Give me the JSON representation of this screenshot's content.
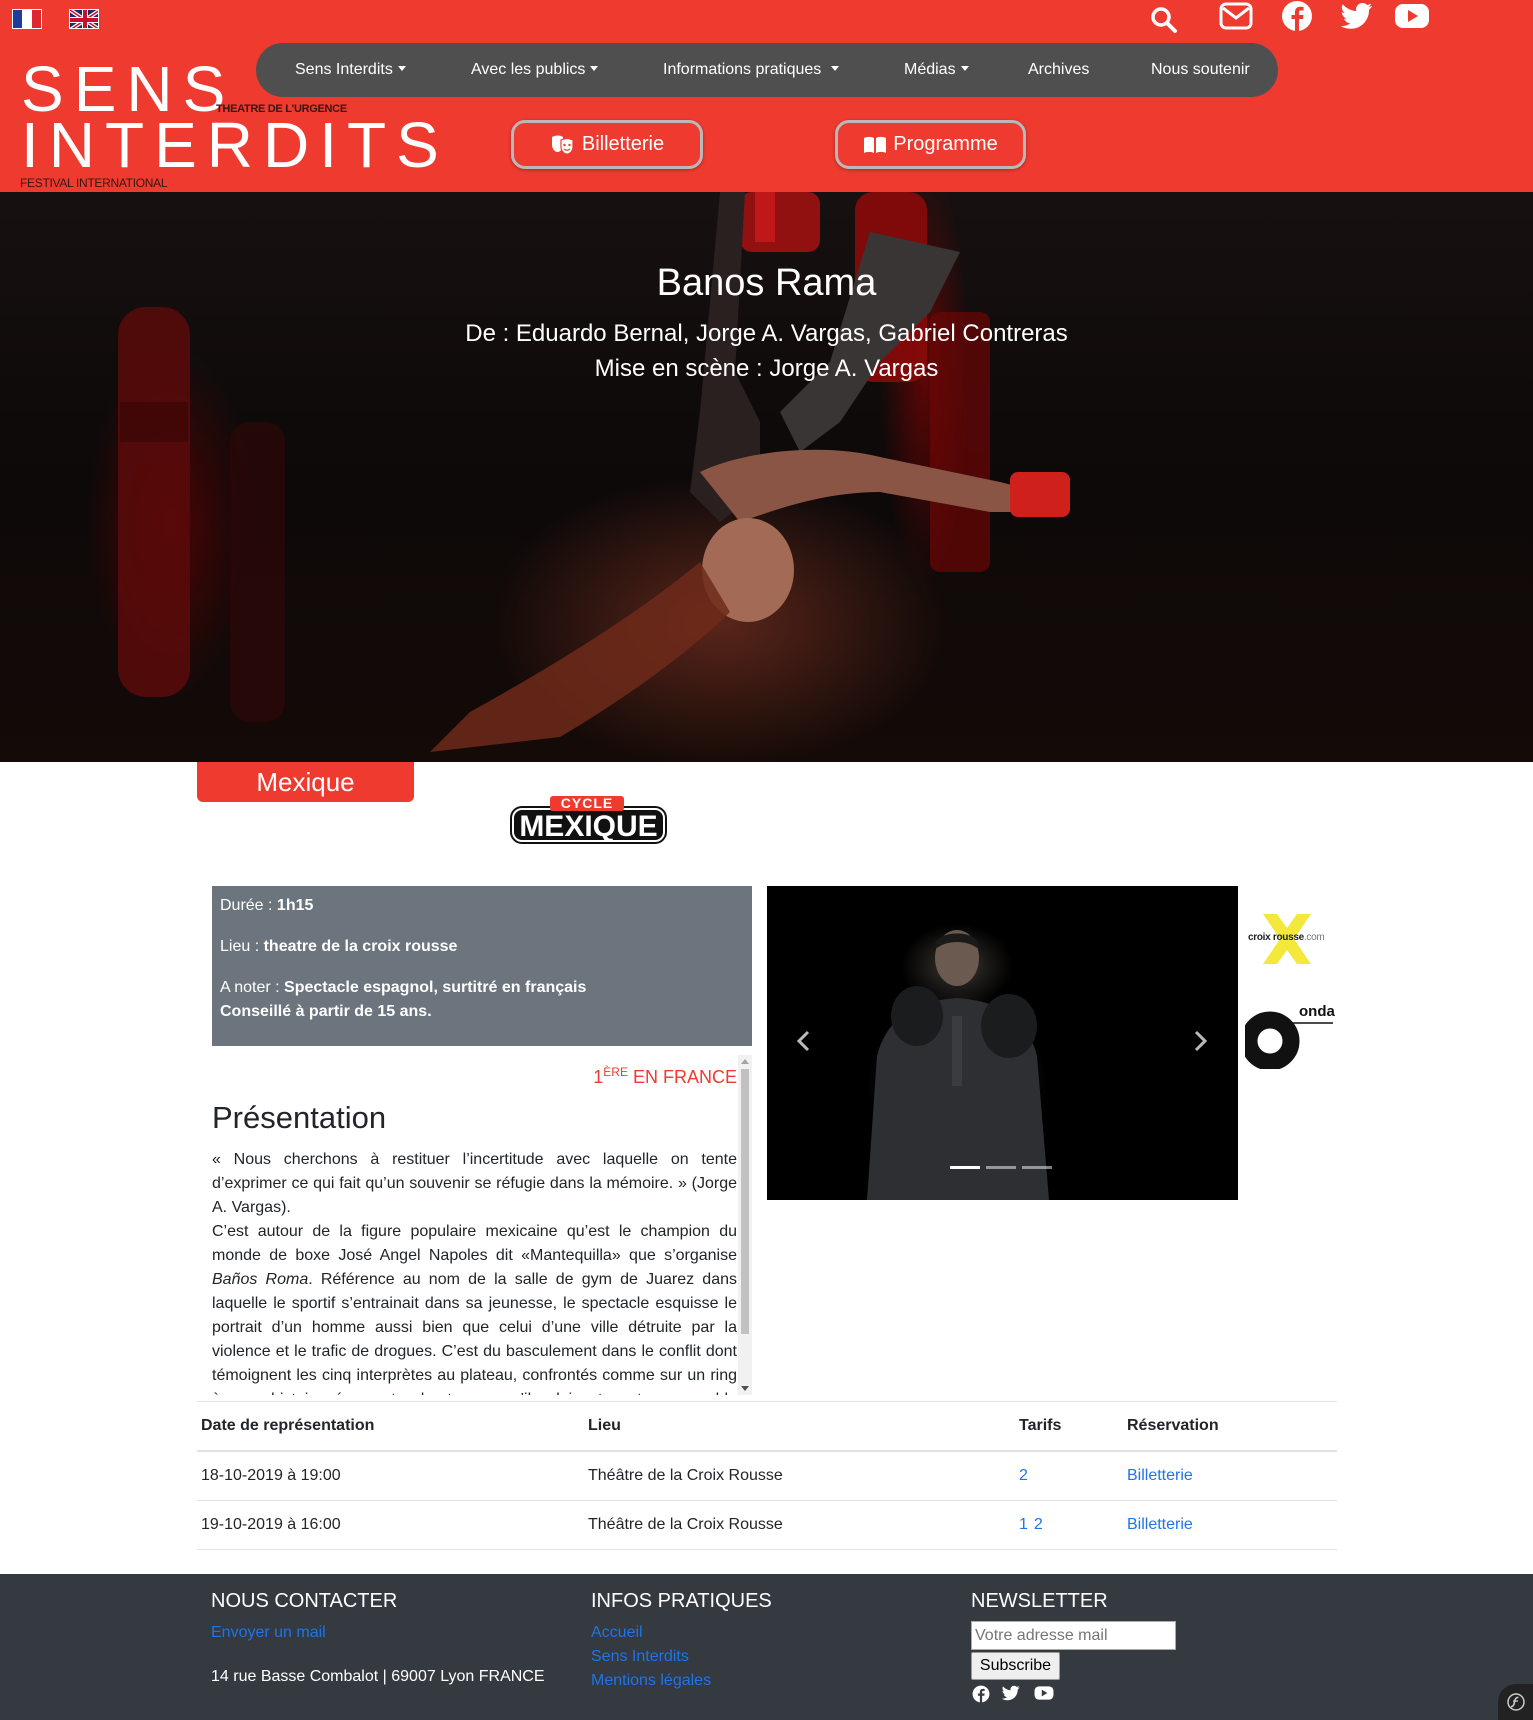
{
  "languages": [
    {
      "name": "Français",
      "icon": "flag-fr-icon"
    },
    {
      "name": "English",
      "icon": "flag-uk-icon"
    }
  ],
  "top_icons": [
    "search-icon",
    "mail-icon",
    "facebook-icon",
    "twitter-icon",
    "youtube-icon"
  ],
  "logo": {
    "line1": "SENS",
    "line2": "INTERDITS",
    "sub1": "THEATRE DE L'URGENCE",
    "sub2": "FESTIVAL INTERNATIONAL"
  },
  "nav": {
    "items": [
      {
        "label": "Sens Interdits",
        "dropdown": true
      },
      {
        "label": "Avec les publics",
        "dropdown": true
      },
      {
        "label": "Informations pratiques ",
        "dropdown": true
      },
      {
        "label": "Médias",
        "dropdown": true
      },
      {
        "label": "Archives",
        "dropdown": false
      },
      {
        "label": "Nous soutenir",
        "dropdown": false
      }
    ]
  },
  "buttons": {
    "billetterie": "Billetterie",
    "programme": "Programme"
  },
  "hero": {
    "title": "Banos Rama",
    "authors": "De : Eduardo Bernal, Jorge A. Vargas, Gabriel Contreras",
    "direction": "Mise en scène : Jorge A. Vargas"
  },
  "country": "Mexique",
  "cycle_logo": {
    "top": "CYCLE",
    "main": "MEXIQUE"
  },
  "info": {
    "duree_label": "Durée : ",
    "duree_value": "1h15",
    "lieu_label": "Lieu : ",
    "lieu_value": "theatre de la croix rousse",
    "noter_label": "A noter : ",
    "noter_value": "Spectacle espagnol, surtitré en français",
    "noter_value2": "Conseillé à partir de 15 ans."
  },
  "presentation": {
    "premiere_num": "1",
    "premiere_sup": "ÈRE",
    "premiere_text": " EN FRANCE",
    "heading": "Présentation",
    "p1": "« Nous cherchons à restituer l’incertitude avec laquelle on tente d’exprimer ce qui fait qu’un souvenir se réfugie dans la mémoire. » (Jorge A. Vargas).",
    "p2a": "C’est autour de la figure populaire mexicaine qu’est le champion du monde de boxe José Angel Napoles dit «Mantequilla» que s’organise ",
    "p2_italic": "Baños Roma",
    "p2b": ". Référence au nom de la salle de gym de Juarez dans laquelle le sportif s’entrainait dans sa jeunesse, le spectacle esquisse le portrait d’un homme aussi bien que celui d’une ville détruite par la violence et le trafic de drogues. C’est du basculement dans le conflit dont témoignent les cinq interprètes au plateau, confrontés comme sur un ring à une histoire écrasante, hanteuse, qu’ils doivent porter ensemble jusqu’au bout."
  },
  "carousel": {
    "slide_count": 3,
    "active_slide": 1
  },
  "partners": [
    {
      "name": "croix rousse.com",
      "part1": "croix ",
      "part2": "rousse",
      "part3": ".com"
    },
    {
      "name": "onda"
    }
  ],
  "table": {
    "headers": [
      "Date de représentation",
      "Lieu",
      "Tarifs",
      "Réservation"
    ],
    "rows": [
      {
        "date": "18-10-2019 à 19:00",
        "lieu": "Théâtre de la Croix Rousse",
        "tarifs": [
          "2"
        ],
        "reservation": "Billetterie"
      },
      {
        "date": "19-10-2019 à 16:00",
        "lieu": "Théâtre de la Croix Rousse",
        "tarifs": [
          "1",
          "2"
        ],
        "reservation": "Billetterie"
      }
    ]
  },
  "footer": {
    "contact": {
      "title": "NOUS CONTACTER",
      "mail_link": "Envoyer un mail",
      "address": "14 rue Basse Combalot | 69007 Lyon FRANCE"
    },
    "infos": {
      "title": "INFOS PRATIQUES",
      "links": [
        "Accueil",
        "Sens Interdits",
        "Mentions légales"
      ]
    },
    "newsletter": {
      "title": "NEWSLETTER",
      "placeholder": "Votre adresse mail",
      "button": "Subscribe"
    }
  },
  "colors": {
    "brand_red": "#ee3a2f",
    "nav_bg": "#4f4f4f",
    "info_bg": "#6c757d",
    "footer_bg": "#343a40",
    "link": "#1e74e8"
  }
}
